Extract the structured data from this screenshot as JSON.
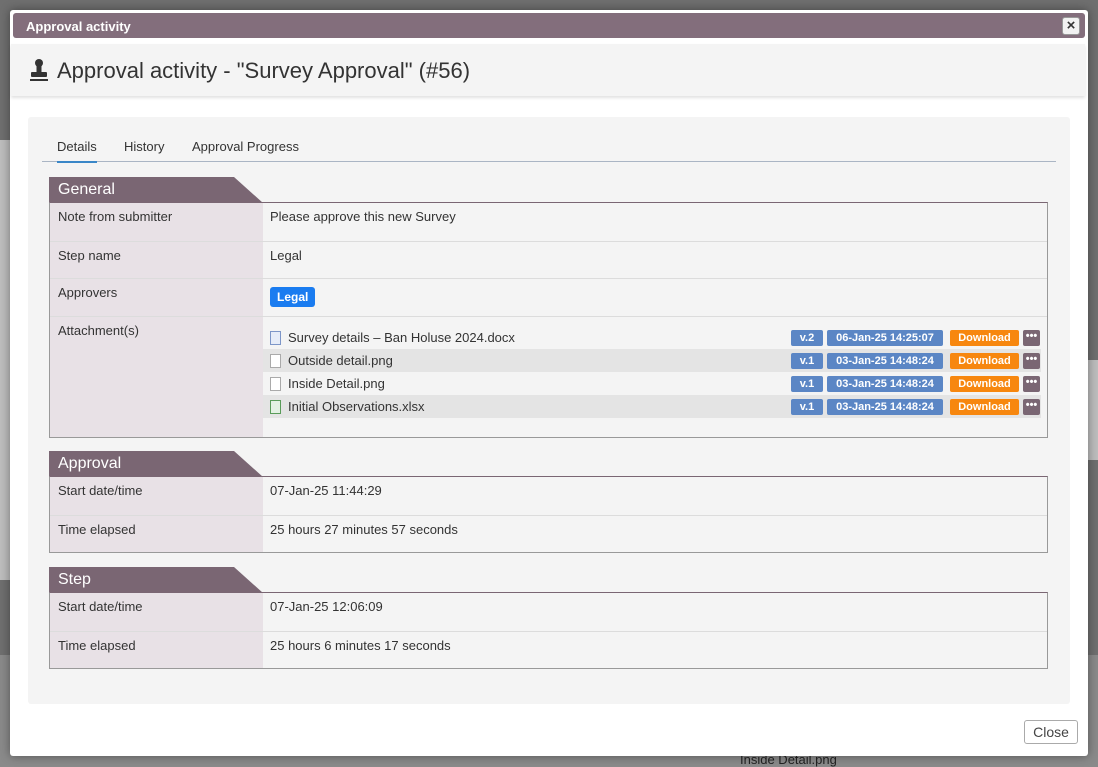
{
  "background": {
    "bottom_text": "Inside Detail.png"
  },
  "dialog": {
    "title": "Approval activity",
    "close_x": "×",
    "page_title": "Approval activity - \"Survey Approval\" (#56)",
    "close_button": "Close"
  },
  "tabs": [
    {
      "label": "Details"
    },
    {
      "label": "History"
    },
    {
      "label": "Approval Progress"
    }
  ],
  "general": {
    "title": "General",
    "note_label": "Note from submitter",
    "note_value": "Please approve this new Survey",
    "step_label": "Step name",
    "step_value": "Legal",
    "approvers_label": "Approvers",
    "approvers_value": "Legal",
    "attachments_label": "Attachment(s)",
    "attachments": [
      {
        "name": "Survey details – Ban Holuse 2024.docx",
        "version": "v.2",
        "date": "06-Jan-25 14:25:07",
        "download": "Download",
        "more": "•••"
      },
      {
        "name": "Outside detail.png",
        "version": "v.1",
        "date": "03-Jan-25 14:48:24",
        "download": "Download",
        "more": "•••"
      },
      {
        "name": "Inside Detail.png",
        "version": "v.1",
        "date": "03-Jan-25 14:48:24",
        "download": "Download",
        "more": "•••"
      },
      {
        "name": "Initial Observations.xlsx",
        "version": "v.1",
        "date": "03-Jan-25 14:48:24",
        "download": "Download",
        "more": "•••"
      }
    ]
  },
  "approval": {
    "title": "Approval",
    "start_label": "Start date/time",
    "start_value": "07-Jan-25 11:44:29",
    "elapsed_label": "Time elapsed",
    "elapsed_value": "25 hours 27 minutes 57 seconds"
  },
  "step": {
    "title": "Step",
    "start_label": "Start date/time",
    "start_value": "07-Jan-25 12:06:09",
    "elapsed_label": "Time elapsed",
    "elapsed_value": "25 hours 6 minutes 17 seconds"
  },
  "colors": {
    "titlebar": "#836e7c",
    "section_header": "#7a6673",
    "label_bg": "#e8e1e6",
    "badge_blue": "#1a7cf0",
    "version_blue": "#5b86c5",
    "download_orange": "#f7870f"
  },
  "icons": {
    "header": "stamp-icon",
    "docx": "word-file-icon",
    "png": "image-file-icon",
    "xlsx": "excel-file-icon"
  }
}
